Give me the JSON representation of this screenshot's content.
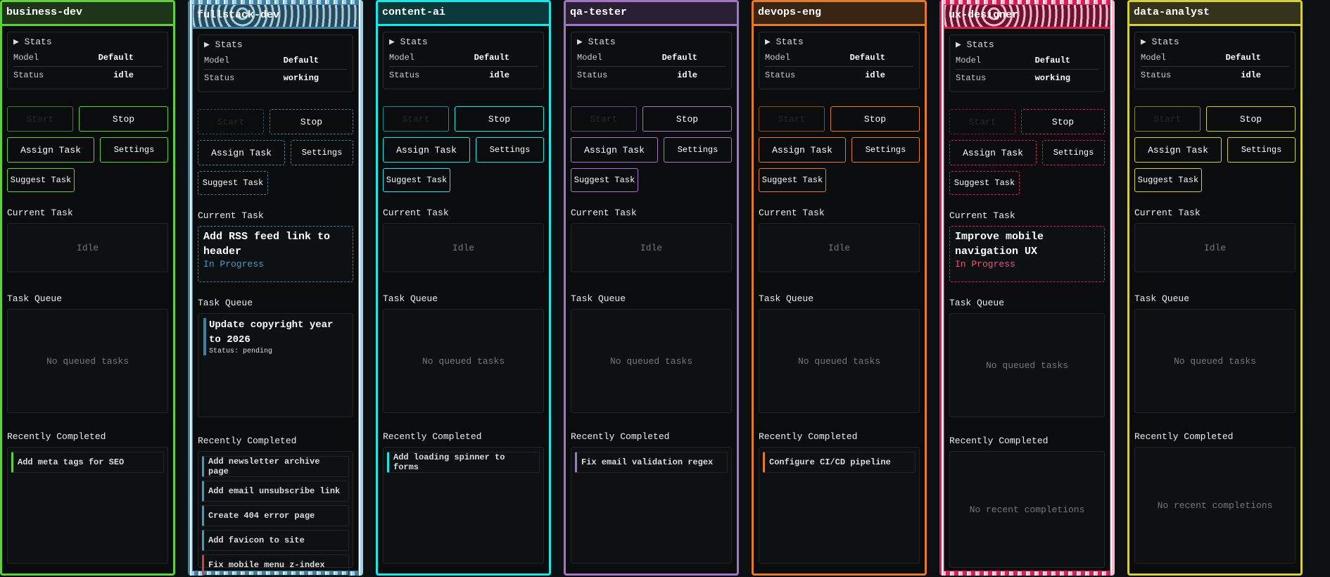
{
  "labels": {
    "stats": "Stats",
    "model": "Model",
    "status": "Status",
    "start": "Start",
    "stop": "Stop",
    "assign": "Assign Task",
    "settings": "Settings",
    "suggest": "Suggest Task",
    "current_task": "Current Task",
    "task_queue": "Task Queue",
    "recently_completed": "Recently Completed",
    "idle": "Idle",
    "no_queue": "No queued tasks",
    "no_recent": "No recent completions"
  },
  "agents": [
    {
      "name": "business-dev",
      "model": "Default",
      "status": "idle",
      "color": "#5fd13a",
      "header_bg": "#1e3519",
      "accent": "#5fd13a",
      "glitch": false,
      "current": null,
      "queue": [],
      "recent": [
        {
          "title": "Add meta tags for SEO",
          "failed": false
        }
      ]
    },
    {
      "name": "fullstack-dev",
      "model": "Default",
      "status": "working",
      "color": "#3f7f9f",
      "color2": "#9fd0e8",
      "header_bg": "#2a4a5a",
      "accent": "#4a9ac0",
      "glitch": true,
      "current": {
        "title": "Add RSS feed link to header",
        "status": "In Progress"
      },
      "queue": [
        {
          "title": "Update copyright year to 2026",
          "status": "Status: pending"
        }
      ],
      "recent": [
        {
          "title": "Add newsletter archive page",
          "failed": false
        },
        {
          "title": "Add email unsubscribe link",
          "failed": false
        },
        {
          "title": "Create 404 error page",
          "failed": false
        },
        {
          "title": "Add favicon to site",
          "failed": false
        },
        {
          "title": "Fix mobile menu z-index",
          "failed": true
        }
      ]
    },
    {
      "name": "content-ai",
      "model": "Default",
      "status": "idle",
      "color": "#19e8e8",
      "header_bg": "#0c3a3c",
      "accent": "#19e8e8",
      "glitch": false,
      "current": null,
      "queue": [],
      "recent": [
        {
          "title": "Add loading spinner to forms",
          "failed": false
        }
      ]
    },
    {
      "name": "qa-tester",
      "model": "Default",
      "status": "idle",
      "color": "#a574c8",
      "header_bg": "#2a2036",
      "accent": "#a574c8",
      "glitch": false,
      "current": null,
      "queue": [],
      "recent": [
        {
          "title": "Fix email validation regex",
          "failed": false
        }
      ]
    },
    {
      "name": "devops-eng",
      "model": "Default",
      "status": "idle",
      "color": "#e57a2c",
      "header_bg": "#3a2414",
      "accent": "#e57a2c",
      "glitch": false,
      "current": null,
      "queue": [],
      "recent": [
        {
          "title": "Configure CI/CD pipeline",
          "failed": false
        }
      ]
    },
    {
      "name": "ux-designer",
      "model": "Default",
      "status": "working",
      "color": "#d81e52",
      "color2": "#ffb8cc",
      "header_bg": "#6a1430",
      "accent": "#f0507a",
      "glitch": true,
      "current": {
        "title": "Improve mobile navigation UX",
        "status": "In Progress"
      },
      "queue": [],
      "recent": []
    },
    {
      "name": "data-analyst",
      "model": "Default",
      "status": "idle",
      "color": "#d4cf3a",
      "header_bg": "#34321a",
      "accent": "#d4cf3a",
      "glitch": false,
      "current": null,
      "queue": [],
      "recent": []
    }
  ]
}
